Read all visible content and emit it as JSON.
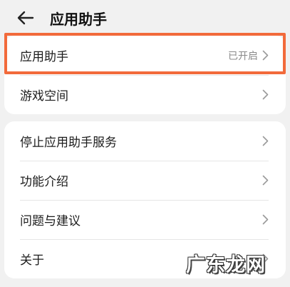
{
  "header": {
    "title": "应用助手"
  },
  "group1": {
    "items": [
      {
        "label": "应用助手",
        "value": "已开启"
      },
      {
        "label": "游戏空间",
        "value": ""
      }
    ]
  },
  "group2": {
    "items": [
      {
        "label": "停止应用助手服务"
      },
      {
        "label": "功能介绍"
      },
      {
        "label": "问题与建议"
      },
      {
        "label": "关于"
      }
    ]
  },
  "watermark": {
    "text": "广东龙网"
  },
  "colors": {
    "highlight": "#f26a3b",
    "chevron": "#9a9a9a"
  }
}
